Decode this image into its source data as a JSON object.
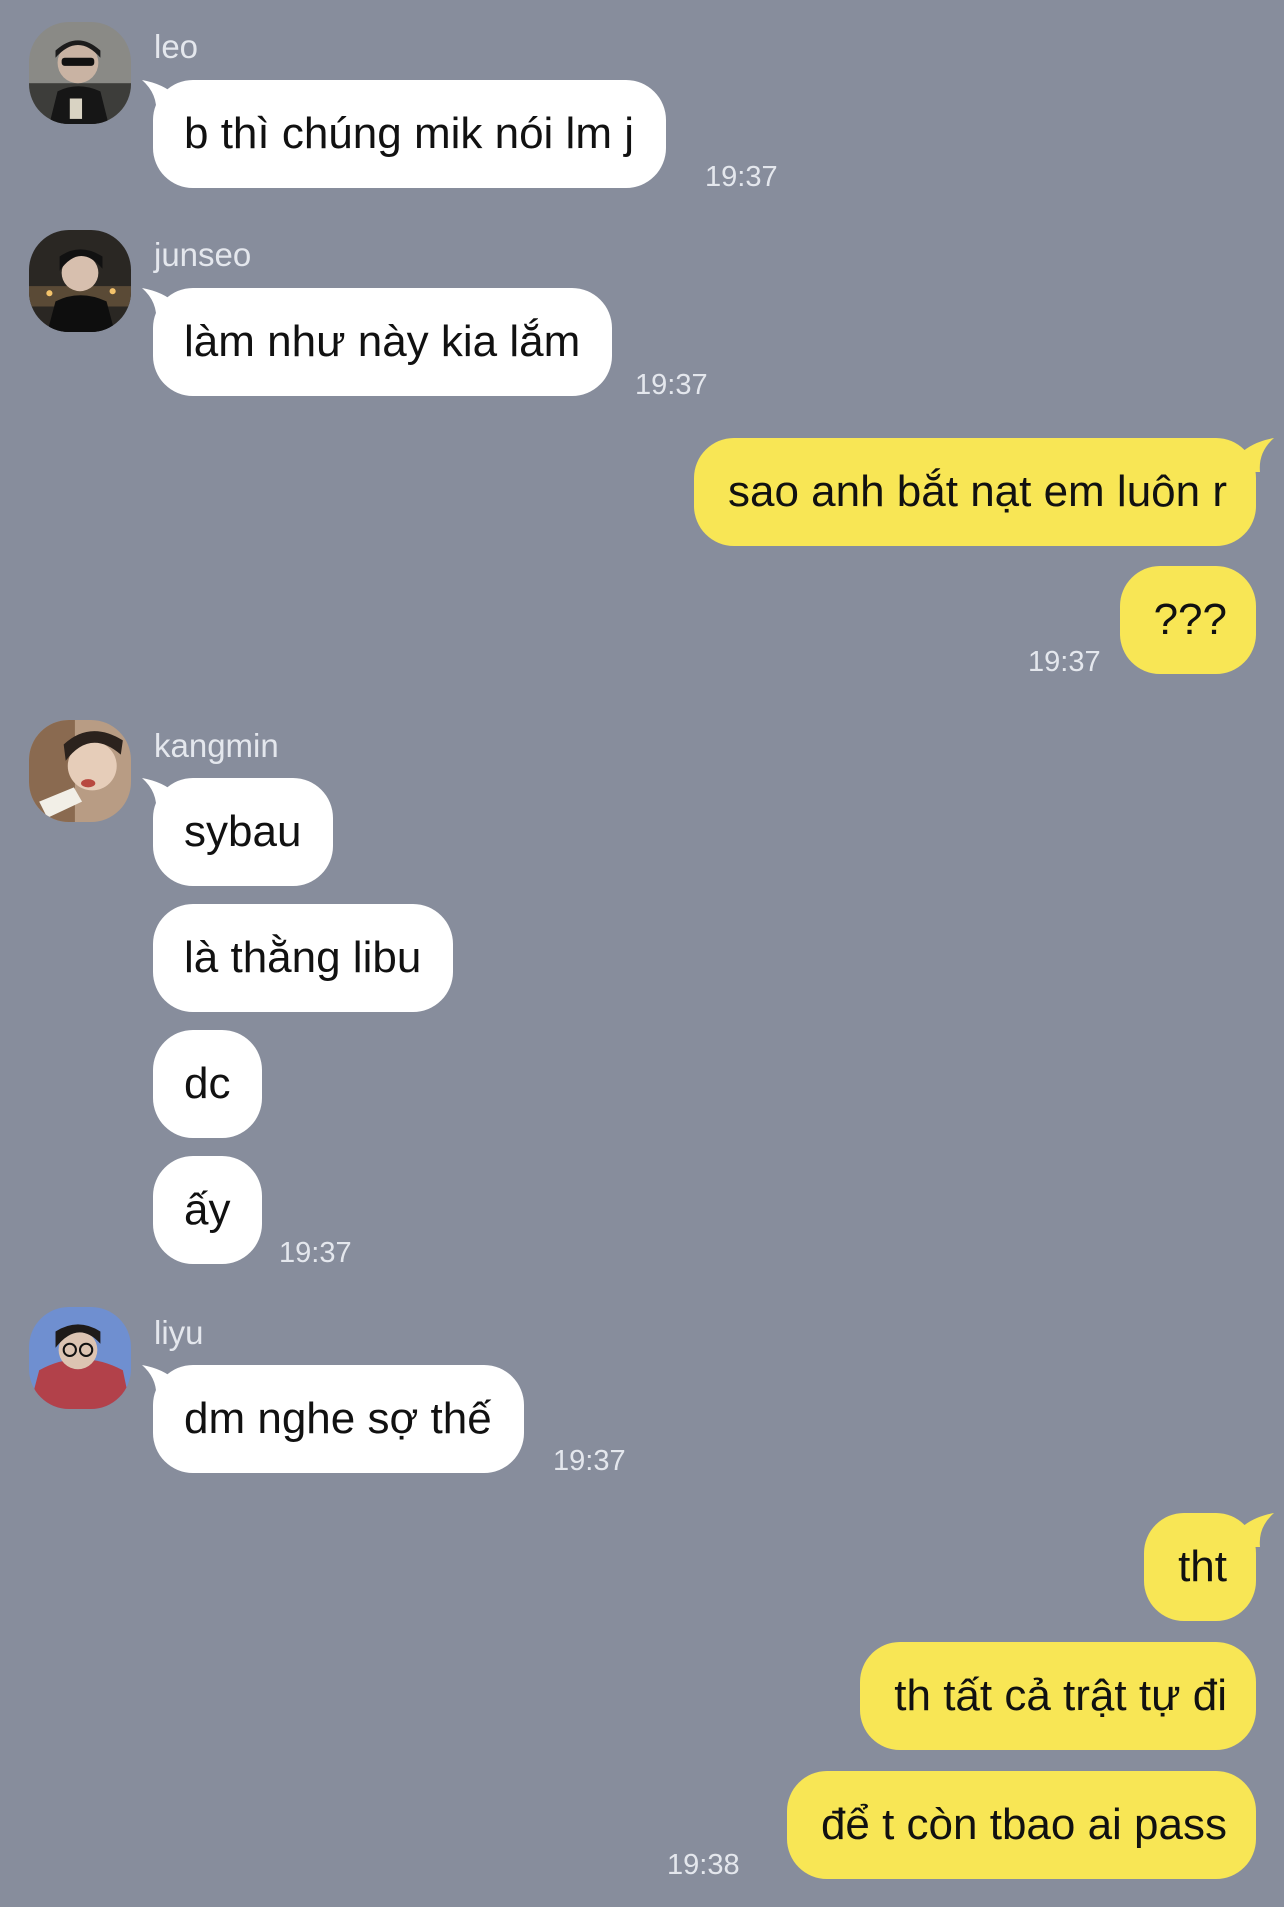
{
  "messages": [
    {
      "sender": "leo",
      "text": "b thì chúng mik nói lm j",
      "time": "19:37"
    },
    {
      "sender": "junseo",
      "text": "làm như này kia lắm",
      "time": "19:37"
    },
    {
      "sender": "me",
      "text": "sao anh bắt nạt em luôn r"
    },
    {
      "sender": "me",
      "text": "???",
      "time": "19:37"
    },
    {
      "sender": "kangmin",
      "text": "sybau"
    },
    {
      "sender": "kangmin",
      "text": "là thằng libu"
    },
    {
      "sender": "kangmin",
      "text": "dc"
    },
    {
      "sender": "kangmin",
      "text": "ấy",
      "time": "19:37"
    },
    {
      "sender": "liyu",
      "text": "dm nghe sợ thế",
      "time": "19:37"
    },
    {
      "sender": "me",
      "text": "tht"
    },
    {
      "sender": "me",
      "text": "th tất cả trật tự đi"
    },
    {
      "sender": "me",
      "text": "để t còn tbao ai pass",
      "time": "19:38"
    }
  ],
  "avatars": {
    "leo": "avatar-photo-leo",
    "junseo": "avatar-photo-junseo",
    "kangmin": "avatar-photo-kangmin",
    "liyu": "avatar-photo-liyu"
  },
  "colors": {
    "background": "#878d9c",
    "incoming_bubble": "#ffffff",
    "outgoing_bubble": "#f8e655",
    "meta_text": "#e4e7ed"
  }
}
